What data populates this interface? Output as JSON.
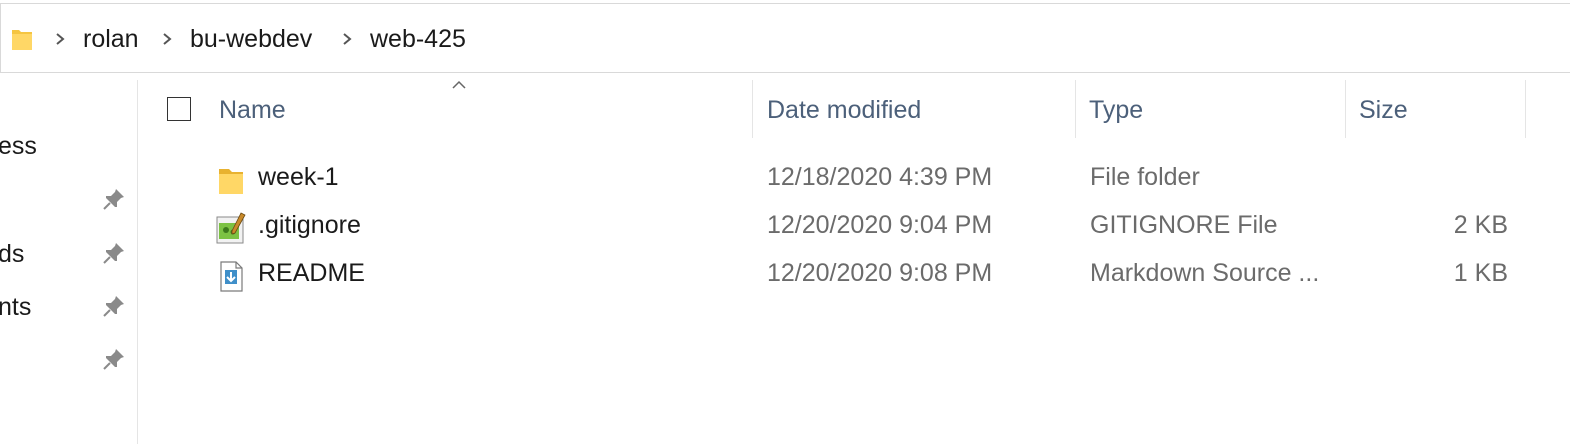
{
  "address_bar": {
    "folder_icon": "folder-icon",
    "separator_icon": "chevron-right-icon",
    "breadcrumbs": [
      "rolan",
      "bu-webdev",
      "web-425"
    ]
  },
  "nav_pane": {
    "items": [
      "ess",
      "ds",
      "nts"
    ],
    "pin_icon": "pin-icon"
  },
  "columns": {
    "name": "Name",
    "date_modified": "Date modified",
    "type": "Type",
    "size": "Size",
    "sort_indicator_icon": "sort-up-caret-icon"
  },
  "files": [
    {
      "name": "week-1",
      "date": "12/18/2020 4:39 PM",
      "type": "File folder",
      "size": "",
      "icon": "folder-icon"
    },
    {
      "name": ".gitignore",
      "date": "12/20/2020 9:04 PM",
      "type": "GITIGNORE File",
      "size": "2 KB",
      "icon": "text-editor-file-icon"
    },
    {
      "name": "README",
      "date": "12/20/2020 9:08 PM",
      "type": "Markdown Source ...",
      "size": "1 KB",
      "icon": "markdown-file-icon"
    }
  ],
  "colors": {
    "folder_yellow": "#f5c542",
    "header_text": "#4c607a",
    "muted_text": "#6b6b6b",
    "border": "#d9d9d9"
  }
}
